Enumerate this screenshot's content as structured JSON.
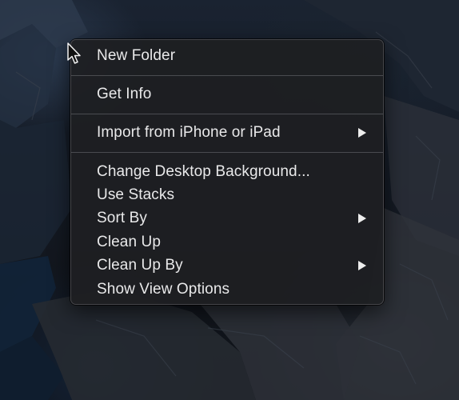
{
  "context_menu": {
    "items": [
      {
        "label": "New Folder"
      },
      {
        "label": "Get Info"
      },
      {
        "label": "Import from iPhone or iPad"
      },
      {
        "label": "Change Desktop Background..."
      },
      {
        "label": "Use Stacks"
      },
      {
        "label": "Sort By"
      },
      {
        "label": "Clean Up"
      },
      {
        "label": "Clean Up By"
      },
      {
        "label": "Show View Options"
      }
    ]
  },
  "icons": {
    "submenu": "chevron-right-icon",
    "pointer": "mouse-pointer-icon"
  },
  "colors": {
    "menu_background": "#1e1f22",
    "menu_text": "#e9e9ea",
    "separator": "#5a5a5e"
  }
}
